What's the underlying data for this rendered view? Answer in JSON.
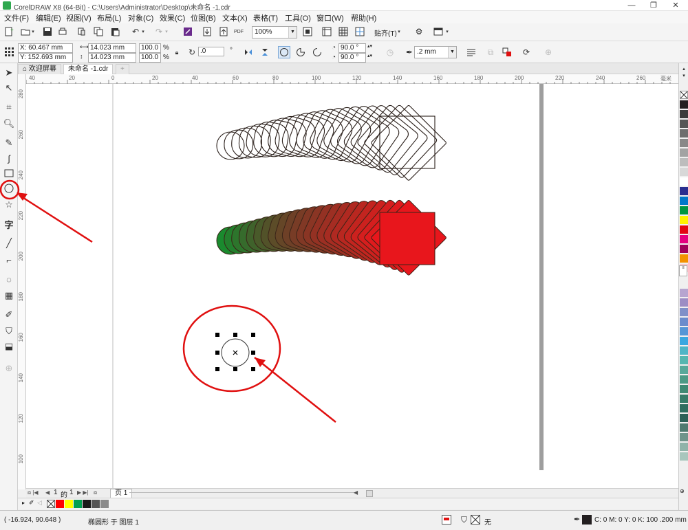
{
  "window": {
    "title": "CorelDRAW X8 (64-Bit) - C:\\Users\\Administrator\\Desktop\\未命名 -1.cdr",
    "minimize": "—",
    "restore": "❐",
    "close": "✕"
  },
  "menu": [
    "文件(F)",
    "编辑(E)",
    "视图(V)",
    "布局(L)",
    "对象(C)",
    "效果(C)",
    "位图(B)",
    "文本(X)",
    "表格(T)",
    "工具(O)",
    "窗口(W)",
    "帮助(H)"
  ],
  "toolbar": {
    "zoom": "100%",
    "snap": "贴齐(T)",
    "pdf_label": "PDF"
  },
  "properties": {
    "x": "X: 60.467 mm",
    "y": "Y: 152.693 mm",
    "width": "14.023 mm",
    "height": "14.023 mm",
    "scale_w": "100.0",
    "scale_h": "100.0",
    "pct": "%",
    "rotation": ".0",
    "rotation_unit": "°",
    "start_angle": "90.0 °",
    "end_angle": "90.0 °",
    "outline_width": ".2 mm"
  },
  "tabs": {
    "welcome": "欢迎屏幕",
    "document": "未命名 -1.cdr",
    "add": "+"
  },
  "ruler_h": [
    "40",
    "20",
    "0",
    "20",
    "40",
    "60",
    "80",
    "100",
    "120",
    "140",
    "160",
    "180",
    "200",
    "220",
    "240",
    "260"
  ],
  "ruler_h_unit": "毫米",
  "ruler_v": [
    "280",
    "260",
    "240",
    "220",
    "200",
    "180",
    "160",
    "140",
    "120",
    "100"
  ],
  "pager": {
    "current": "1",
    "of": "的",
    "total": "1",
    "page_tab": "页 1"
  },
  "status": {
    "cursor": "( -16.924, 90.648 )",
    "object": "椭圆形 于 图层 1",
    "fill": "无",
    "outline": "C: 0 M: 0 Y: 0 K: 100  .200 mm"
  },
  "colors": {
    "accent_red": "#e8161c",
    "annotation_red": "#e01010",
    "canvas": "#ffffff"
  },
  "palette": [
    "#231f20",
    "#3b3b3b",
    "#555555",
    "#6e6e6e",
    "#888888",
    "#a3a3a3",
    "#bdbdbd",
    "#d8d8d8",
    "#ffffff",
    "#2a2d8f",
    "#0078c8",
    "#009640",
    "#fff200",
    "#e30613",
    "#e4007f",
    "#a0005a",
    "#f39200",
    "#f7c7cc",
    "#b7a5d0",
    "#9d8dc4",
    "#8090c8",
    "#6b8ccc",
    "#5596d6",
    "#3aa7e0",
    "#4fb5c6",
    "#56b6b0",
    "#58a89a",
    "#4d9a86",
    "#3f8a74",
    "#367c69",
    "#2f6e60",
    "#2d6158",
    "#4f7a70",
    "#70948b",
    "#8fb3a9",
    "#a8c6bd"
  ],
  "doc_palette": [
    "#ff0000",
    "#ffff00",
    "#00a050",
    "#1a1a1a",
    "#555555",
    "#8a8a8a"
  ]
}
